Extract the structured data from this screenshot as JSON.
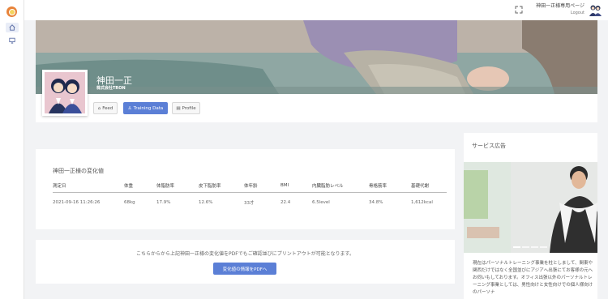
{
  "topbar": {
    "user_name": "神田一正様専用ページ",
    "logout": "Logout"
  },
  "profile": {
    "name": "神田一正",
    "company": "株式会社TRON"
  },
  "tabs": [
    {
      "label": "Feed",
      "icon": "home-icon"
    },
    {
      "label": "Training Data",
      "icon": "user-icon"
    },
    {
      "label": "Profile",
      "icon": "id-card-icon"
    }
  ],
  "changes": {
    "title": "神田一正様の変化値",
    "columns": [
      "測定日",
      "体重",
      "体脂肪率",
      "皮下脂肪率",
      "体年齢",
      "BMI",
      "内臓脂肪レベル",
      "骨格筋率",
      "基礎代謝"
    ],
    "rows": [
      [
        "2021-09-16 11:26:26",
        "68kg",
        "17.9%",
        "12.6%",
        "33才",
        "22.4",
        "6.5level",
        "34.8%",
        "1,612kcal"
      ]
    ]
  },
  "pdf": {
    "text": "こちらからから上記神田一正様の変化値をPDFでもご確認並びにプリントアウトが可能となります。",
    "button": "変化値の情報をPDFへ"
  },
  "ad": {
    "title": "サービス広告",
    "text": "現在はパーソナルトレーニング事業を柱としまして、関東や関西だけではなく全国並びにアジアへ出張にてお客様の元へお伺いもしております。オフィス出張以外のパーソナルトレーニング事業としては、男性向けと女性向けでの個人様向けのパーソナ"
  },
  "colors": {
    "accent": "#5b7fd6",
    "background": "#f2f3f5"
  }
}
